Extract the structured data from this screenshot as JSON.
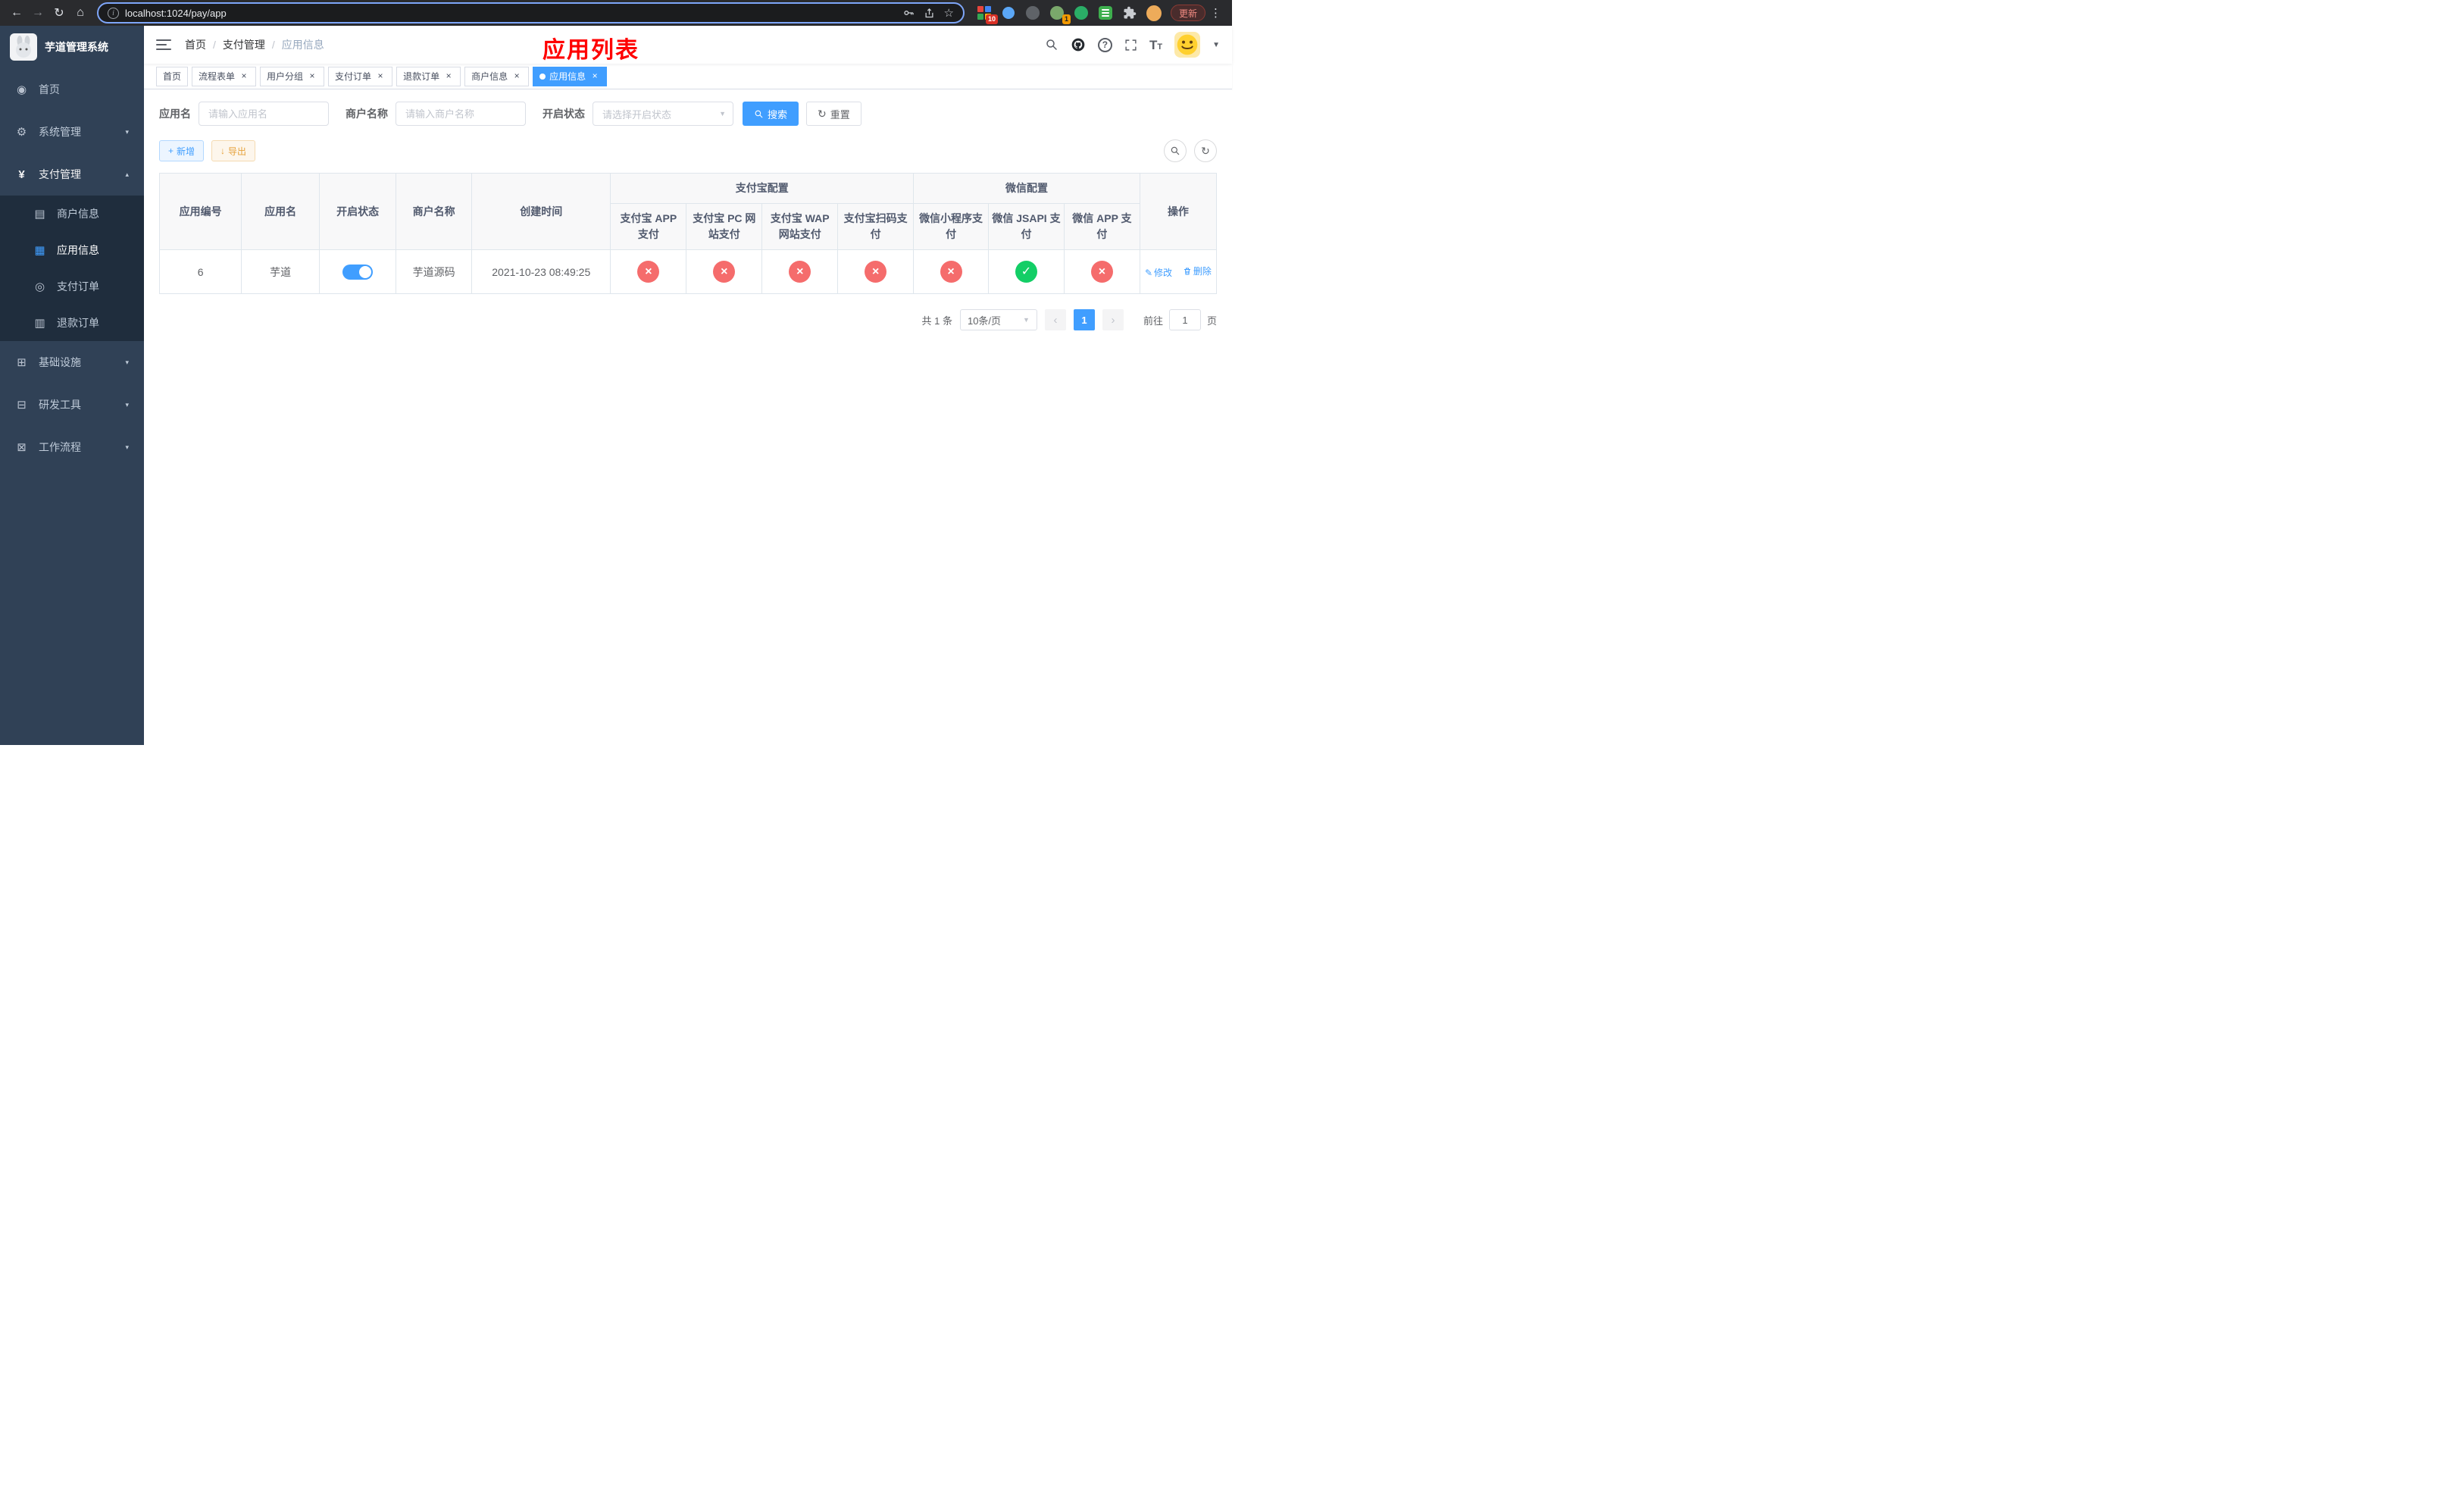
{
  "browser": {
    "url": "localhost:1024/pay/app",
    "update_label": "更新",
    "badge_10": "10",
    "badge_1": "1"
  },
  "glyphs": {
    "back": "←",
    "forward": "→",
    "reload": "↻",
    "home": "⌂",
    "star": "☆",
    "kebab": "⋮",
    "info": "i",
    "close": "×",
    "caret_down": "▼",
    "chevron_down": "▾",
    "chevron_up": "▴",
    "check": "✓",
    "cross": "×",
    "plus": "+",
    "download": "↓",
    "refresh": "↻",
    "prev": "‹",
    "next": "›",
    "question": "?",
    "sep": "/",
    "size_big": "T",
    "size_small": "T",
    "edit_pencil": "✎"
  },
  "colors": {
    "primary": "#409eff",
    "success": "#13ce66",
    "danger": "#f56c6c",
    "warning": "#e6a23c",
    "annotation": "#ff0000",
    "sidebar_bg": "#304156",
    "submenu_bg": "#1f2d3d"
  },
  "sidebar": {
    "app_title": "芋道管理系统",
    "items": [
      {
        "label": "首页",
        "icon": "◉"
      },
      {
        "label": "系统管理",
        "icon": "⚙"
      },
      {
        "label": "支付管理",
        "icon": "¥",
        "children": [
          {
            "label": "商户信息",
            "icon": "▤"
          },
          {
            "label": "应用信息",
            "icon": "▦"
          },
          {
            "label": "支付订单",
            "icon": "◎"
          },
          {
            "label": "退款订单",
            "icon": "▥"
          }
        ]
      },
      {
        "label": "基础设施",
        "icon": "⊞"
      },
      {
        "label": "研发工具",
        "icon": "⊟"
      },
      {
        "label": "工作流程",
        "icon": "⊠"
      }
    ]
  },
  "header": {
    "breadcrumb": [
      "首页",
      "支付管理",
      "应用信息"
    ],
    "overlay_title": "应用列表"
  },
  "tags": [
    {
      "label": "首页"
    },
    {
      "label": "流程表单"
    },
    {
      "label": "用户分组"
    },
    {
      "label": "支付订单"
    },
    {
      "label": "退款订单"
    },
    {
      "label": "商户信息"
    },
    {
      "label": "应用信息"
    }
  ],
  "filters": {
    "app_name_label": "应用名",
    "app_name_placeholder": "请输入应用名",
    "merchant_label": "商户名称",
    "merchant_placeholder": "请输入商户名称",
    "status_label": "开启状态",
    "status_placeholder": "请选择开启状态",
    "search_button": "搜索",
    "reset_button": "重置"
  },
  "actions": {
    "add_label": "新增",
    "export_label": "导出"
  },
  "table": {
    "simple_cols": [
      "应用编号",
      "应用名",
      "开启状态",
      "商户名称",
      "创建时间"
    ],
    "groups": [
      {
        "label": "支付宝配置",
        "cols": [
          "支付宝 APP 支付",
          "支付宝 PC 网站支付",
          "支付宝 WAP 网站支付",
          "支付宝扫码支付"
        ]
      },
      {
        "label": "微信配置",
        "cols": [
          "微信小程序支付",
          "微信 JSAPI 支付",
          "微信 APP 支付"
        ]
      }
    ],
    "op_col": "操作",
    "row": {
      "id": "6",
      "name": "芋道",
      "enabled": true,
      "merchant": "芋道源码",
      "created": "2021-10-23 08:49:25",
      "statuses": [
        "no",
        "no",
        "no",
        "no",
        "no",
        "yes",
        "no"
      ],
      "edit_label": "修改",
      "delete_label": "删除"
    }
  },
  "pagination": {
    "total": "共 1 条",
    "page_size": "10条/页",
    "page": "1",
    "goto_label": "前往",
    "goto_value": "1",
    "page_unit": "页"
  }
}
